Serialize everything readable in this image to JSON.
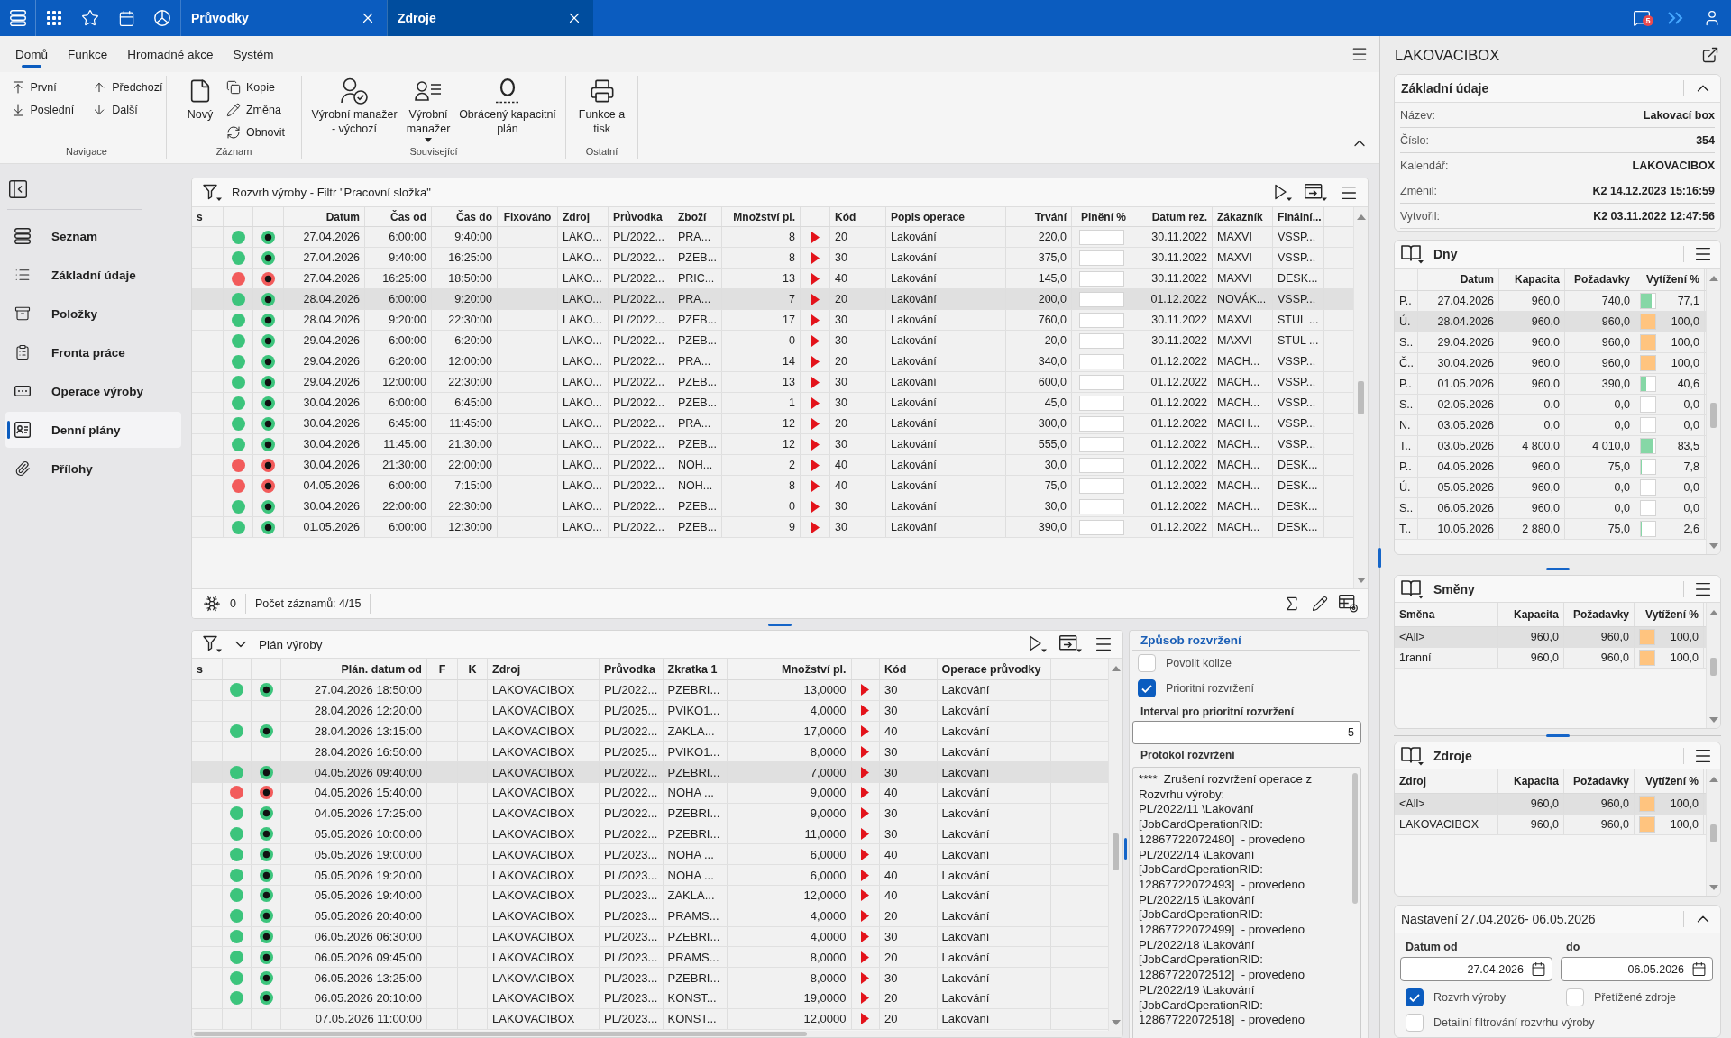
{
  "app_bar": {
    "tabs": [
      {
        "label": "Průvodky",
        "selected": false
      },
      {
        "label": "Zdroje",
        "selected": true
      }
    ],
    "notifications": "5"
  },
  "ribbon": {
    "tabs": [
      {
        "label": "Domů",
        "selected": true
      },
      {
        "label": "Funkce",
        "selected": false
      },
      {
        "label": "Hromadné akce",
        "selected": false
      },
      {
        "label": "Systém",
        "selected": false
      }
    ],
    "groups": [
      {
        "label": "Navigace",
        "kind": "grid",
        "items": [
          {
            "label": "První",
            "kind": "small"
          },
          {
            "label": "Předchozí",
            "kind": "small"
          },
          {
            "label": "Poslední",
            "kind": "small"
          },
          {
            "label": "Další",
            "kind": "small"
          }
        ]
      },
      {
        "label": "Záznam",
        "kind": "stack",
        "items": [
          {
            "label": "Nový",
            "kind": "large"
          },
          {
            "label": "Kopie",
            "kind": "small"
          },
          {
            "label": "Změna",
            "kind": "small"
          },
          {
            "label": "Obnovit",
            "kind": "small"
          }
        ]
      },
      {
        "label": "Související",
        "items": [
          {
            "label": "Výrobní manažer - výchozí",
            "kind": "large"
          },
          {
            "label": "Výrobní manažer",
            "kind": "menu"
          },
          {
            "label": "Obrácený kapacitní plán",
            "kind": "large"
          }
        ]
      },
      {
        "label": "Ostatní",
        "items": [
          {
            "label": "Funkce a tisk",
            "kind": "large"
          }
        ]
      }
    ]
  },
  "sidebar": {
    "items": [
      {
        "label": "Seznam",
        "selected": false
      },
      {
        "label": "Základní údaje",
        "selected": false
      },
      {
        "label": "Položky",
        "selected": false
      },
      {
        "label": "Fronta práce",
        "selected": false
      },
      {
        "label": "Operace výroby",
        "selected": false
      },
      {
        "label": "Denní plány",
        "selected": true
      },
      {
        "label": "Přílohy",
        "selected": false
      }
    ]
  },
  "schedule": {
    "title": "Rozvrh výroby - Filtr \"Pracovní složka\"",
    "columns": [
      {
        "label": "s",
        "kind": "text"
      },
      {
        "kind": "dot"
      },
      {
        "kind": "ring"
      },
      {
        "label": "Datum",
        "kind": "num"
      },
      {
        "label": "Čas od",
        "kind": "num"
      },
      {
        "label": "Čas do",
        "kind": "num"
      },
      {
        "label": "Fixováno",
        "kind": "center"
      },
      {
        "label": "Zdroj",
        "kind": "text"
      },
      {
        "label": "Průvodka",
        "kind": "text"
      },
      {
        "label": "Zboží",
        "kind": "text"
      },
      {
        "label": "Množství pl.",
        "kind": "num"
      },
      {
        "kind": "flag"
      },
      {
        "label": "Kód",
        "kind": "text"
      },
      {
        "label": "Popis operace",
        "kind": "text"
      },
      {
        "label": "Trvání",
        "kind": "num"
      },
      {
        "label": "Plnění %",
        "kind": "bar"
      },
      {
        "label": "Datum rez.",
        "kind": "num"
      },
      {
        "label": "Zákazník",
        "kind": "text"
      },
      {
        "label": "Finální...",
        "kind": "text"
      }
    ],
    "rows": [
      {
        "status": {
          "color": "#3cc47c"
        },
        "state": {
          "color": "#3cc47c"
        },
        "datum": "27.04.2026",
        "od": "6:00:00",
        "cas_do": "9:40:00",
        "zdroj": "LAKO...",
        "pruvodka": "PL/2022...",
        "zbozi": "PRA...",
        "mnozstvi": "8",
        "kod": "20",
        "popis": "Lakování",
        "trvani": "220,0",
        "plneni": {
          "level": 0
        },
        "rez": "30.11.2022",
        "zakaznik": "MAXVI",
        "finalni": "VSSP...",
        "selected": false
      },
      {
        "status": {
          "color": "#3cc47c"
        },
        "state": {
          "color": "#3cc47c"
        },
        "datum": "27.04.2026",
        "od": "9:40:00",
        "cas_do": "16:25:00",
        "zdroj": "LAKO...",
        "pruvodka": "PL/2022...",
        "zbozi": "PZEB...",
        "mnozstvi": "8",
        "kod": "30",
        "popis": "Lakování",
        "trvani": "375,0",
        "plneni": {
          "level": 0
        },
        "rez": "30.11.2022",
        "zakaznik": "MAXVI",
        "finalni": "VSSP...",
        "selected": false
      },
      {
        "status": {
          "color": "#f25b5b"
        },
        "state": {
          "color": "#f25b5b"
        },
        "datum": "27.04.2026",
        "od": "16:25:00",
        "cas_do": "18:50:00",
        "zdroj": "LAKO...",
        "pruvodka": "PL/2022...",
        "zbozi": "PRIC...",
        "mnozstvi": "13",
        "kod": "40",
        "popis": "Lakování",
        "trvani": "145,0",
        "plneni": {
          "level": 0
        },
        "rez": "30.11.2022",
        "zakaznik": "MAXVI",
        "finalni": "DESK...",
        "selected": false
      },
      {
        "status": {
          "color": "#3cc47c"
        },
        "state": {
          "color": "#3cc47c"
        },
        "datum": "28.04.2026",
        "od": "6:00:00",
        "cas_do": "9:20:00",
        "zdroj": "LAKO...",
        "pruvodka": "PL/2022...",
        "zbozi": "PRA...",
        "mnozstvi": "7",
        "kod": "20",
        "popis": "Lakování",
        "trvani": "200,0",
        "plneni": {
          "level": 0
        },
        "rez": "01.12.2022",
        "zakaznik": "NOVÁK...",
        "finalni": "VSSP...",
        "selected": true
      },
      {
        "status": {
          "color": "#3cc47c"
        },
        "state": {
          "color": "#3cc47c"
        },
        "datum": "28.04.2026",
        "od": "9:20:00",
        "cas_do": "22:30:00",
        "zdroj": "LAKO...",
        "pruvodka": "PL/2022...",
        "zbozi": "PZEB...",
        "mnozstvi": "17",
        "kod": "30",
        "popis": "Lakování",
        "trvani": "760,0",
        "plneni": {
          "level": 0
        },
        "rez": "30.11.2022",
        "zakaznik": "MAXVI",
        "finalni": "STUL ...",
        "selected": false
      },
      {
        "status": {
          "color": "#3cc47c"
        },
        "state": {
          "color": "#3cc47c"
        },
        "datum": "29.04.2026",
        "od": "6:00:00",
        "cas_do": "6:20:00",
        "zdroj": "LAKO...",
        "pruvodka": "PL/2022...",
        "zbozi": "PZEB...",
        "mnozstvi": "0",
        "kod": "30",
        "popis": "Lakování",
        "trvani": "20,0",
        "plneni": {
          "level": 0
        },
        "rez": "30.11.2022",
        "zakaznik": "MAXVI",
        "finalni": "STUL ...",
        "selected": false
      },
      {
        "status": {
          "color": "#3cc47c"
        },
        "state": {
          "color": "#3cc47c"
        },
        "datum": "29.04.2026",
        "od": "6:20:00",
        "cas_do": "12:00:00",
        "zdroj": "LAKO...",
        "pruvodka": "PL/2022...",
        "zbozi": "PRA...",
        "mnozstvi": "14",
        "kod": "20",
        "popis": "Lakování",
        "trvani": "340,0",
        "plneni": {
          "level": 0
        },
        "rez": "01.12.2022",
        "zakaznik": "MACH...",
        "finalni": "VSSP...",
        "selected": false
      },
      {
        "status": {
          "color": "#3cc47c"
        },
        "state": {
          "color": "#3cc47c"
        },
        "datum": "29.04.2026",
        "od": "12:00:00",
        "cas_do": "22:30:00",
        "zdroj": "LAKO...",
        "pruvodka": "PL/2022...",
        "zbozi": "PZEB...",
        "mnozstvi": "13",
        "kod": "30",
        "popis": "Lakování",
        "trvani": "600,0",
        "plneni": {
          "level": 0
        },
        "rez": "01.12.2022",
        "zakaznik": "MACH...",
        "finalni": "VSSP...",
        "selected": false
      },
      {
        "status": {
          "color": "#3cc47c"
        },
        "state": {
          "color": "#3cc47c"
        },
        "datum": "30.04.2026",
        "od": "6:00:00",
        "cas_do": "6:45:00",
        "zdroj": "LAKO...",
        "pruvodka": "PL/2022...",
        "zbozi": "PZEB...",
        "mnozstvi": "1",
        "kod": "30",
        "popis": "Lakování",
        "trvani": "45,0",
        "plneni": {
          "level": 0
        },
        "rez": "01.12.2022",
        "zakaznik": "MACH...",
        "finalni": "VSSP...",
        "selected": false
      },
      {
        "status": {
          "color": "#3cc47c"
        },
        "state": {
          "color": "#3cc47c"
        },
        "datum": "30.04.2026",
        "od": "6:45:00",
        "cas_do": "11:45:00",
        "zdroj": "LAKO...",
        "pruvodka": "PL/2022...",
        "zbozi": "PRA...",
        "mnozstvi": "12",
        "kod": "20",
        "popis": "Lakování",
        "trvani": "300,0",
        "plneni": {
          "level": 0
        },
        "rez": "01.12.2022",
        "zakaznik": "MACH...",
        "finalni": "VSSP...",
        "selected": false
      },
      {
        "status": {
          "color": "#3cc47c"
        },
        "state": {
          "color": "#3cc47c"
        },
        "datum": "30.04.2026",
        "od": "11:45:00",
        "cas_do": "21:30:00",
        "zdroj": "LAKO...",
        "pruvodka": "PL/2022...",
        "zbozi": "PZEB...",
        "mnozstvi": "12",
        "kod": "30",
        "popis": "Lakování",
        "trvani": "555,0",
        "plneni": {
          "level": 0
        },
        "rez": "01.12.2022",
        "zakaznik": "MACH...",
        "finalni": "VSSP...",
        "selected": false
      },
      {
        "status": {
          "color": "#f25b5b"
        },
        "state": {
          "color": "#f25b5b"
        },
        "datum": "30.04.2026",
        "od": "21:30:00",
        "cas_do": "22:00:00",
        "zdroj": "LAKO...",
        "pruvodka": "PL/2022...",
        "zbozi": "NOH...",
        "mnozstvi": "2",
        "kod": "40",
        "popis": "Lakování",
        "trvani": "30,0",
        "plneni": {
          "level": 0
        },
        "rez": "01.12.2022",
        "zakaznik": "MACH...",
        "finalni": "DESK...",
        "selected": false
      },
      {
        "status": {
          "color": "#f25b5b"
        },
        "state": {
          "color": "#f25b5b"
        },
        "datum": "04.05.2026",
        "od": "6:00:00",
        "cas_do": "7:15:00",
        "zdroj": "LAKO...",
        "pruvodka": "PL/2022...",
        "zbozi": "NOH...",
        "mnozstvi": "8",
        "kod": "40",
        "popis": "Lakování",
        "trvani": "75,0",
        "plneni": {
          "level": 0
        },
        "rez": "01.12.2022",
        "zakaznik": "MACH...",
        "finalni": "DESK...",
        "selected": false
      },
      {
        "status": {
          "color": "#3cc47c"
        },
        "state": {
          "color": "#3cc47c"
        },
        "datum": "30.04.2026",
        "od": "22:00:00",
        "cas_do": "22:30:00",
        "zdroj": "LAKO...",
        "pruvodka": "PL/2022...",
        "zbozi": "PZEB...",
        "mnozstvi": "0",
        "kod": "30",
        "popis": "Lakování",
        "trvani": "30,0",
        "plneni": {
          "level": 0
        },
        "rez": "01.12.2022",
        "zakaznik": "MACH...",
        "finalni": "DESK...",
        "selected": false
      },
      {
        "status": {
          "color": "#3cc47c"
        },
        "state": {
          "color": "#3cc47c"
        },
        "datum": "01.05.2026",
        "od": "6:00:00",
        "cas_do": "12:30:00",
        "zdroj": "LAKO...",
        "pruvodka": "PL/2022...",
        "zbozi": "PZEB...",
        "mnozstvi": "9",
        "kod": "30",
        "popis": "Lakování",
        "trvani": "390,0",
        "plneni": {
          "level": 0
        },
        "rez": "01.12.2022",
        "zakaznik": "MACH...",
        "finalni": "DESK...",
        "selected": false
      }
    ],
    "footer": {
      "count": "0",
      "records": "Počet záznamů: 4/15"
    }
  },
  "plan": {
    "title": "Plán výroby",
    "columns": [
      {
        "label": "s",
        "kind": "text"
      },
      {
        "kind": "dot"
      },
      {
        "kind": "ring"
      },
      {
        "label": "Plán. datum od",
        "kind": "num"
      },
      {
        "label": "F",
        "kind": "center"
      },
      {
        "label": "K",
        "kind": "center"
      },
      {
        "label": "Zdroj",
        "kind": "text"
      },
      {
        "label": "Průvodka",
        "kind": "text"
      },
      {
        "label": "Zkratka 1",
        "kind": "text"
      },
      {
        "label": "Množství pl.",
        "kind": "num"
      },
      {
        "kind": "flag"
      },
      {
        "label": "Kód",
        "kind": "text"
      },
      {
        "label": "Operace průvodky",
        "kind": "text"
      }
    ],
    "rows": [
      {
        "status": {
          "color": "#3cc47c"
        },
        "state": {
          "color": "#3cc47c"
        },
        "datum": "27.04.2026 18:50:00",
        "zdroj": "LAKOVACIBOX",
        "pruvodka": "PL/2022...",
        "zkratka": "PZEBRI...",
        "mnozstvi": "13,0000",
        "kod": "30",
        "operace": "Lakování",
        "selected": false
      },
      {
        "datum": "28.04.2026 12:20:00",
        "zdroj": "LAKOVACIBOX",
        "pruvodka": "PL/2025...",
        "zkratka": "PVIKO1...",
        "mnozstvi": "4,0000",
        "kod": "30",
        "operace": "Lakování",
        "selected": false
      },
      {
        "status": {
          "color": "#3cc47c"
        },
        "state": {
          "color": "#3cc47c"
        },
        "datum": "28.04.2026 13:15:00",
        "zdroj": "LAKOVACIBOX",
        "pruvodka": "PL/2022...",
        "zkratka": "ZAKLA...",
        "mnozstvi": "17,0000",
        "kod": "40",
        "operace": "Lakování",
        "selected": false
      },
      {
        "datum": "28.04.2026 16:50:00",
        "zdroj": "LAKOVACIBOX",
        "pruvodka": "PL/2025...",
        "zkratka": "PVIKO1...",
        "mnozstvi": "8,0000",
        "kod": "30",
        "operace": "Lakování",
        "selected": false
      },
      {
        "status": {
          "color": "#3cc47c"
        },
        "state": {
          "color": "#3cc47c"
        },
        "datum": "04.05.2026 09:40:00",
        "zdroj": "LAKOVACIBOX",
        "pruvodka": "PL/2022...",
        "zkratka": "PZEBRI...",
        "mnozstvi": "7,0000",
        "kod": "30",
        "operace": "Lakování",
        "selected": true
      },
      {
        "status": {
          "color": "#f25b5b"
        },
        "state": {
          "color": "#f25b5b"
        },
        "datum": "04.05.2026 15:40:00",
        "zdroj": "LAKOVACIBOX",
        "pruvodka": "PL/2022...",
        "zkratka": "NOHA ...",
        "mnozstvi": "9,0000",
        "kod": "40",
        "operace": "Lakování",
        "selected": false
      },
      {
        "status": {
          "color": "#3cc47c"
        },
        "state": {
          "color": "#3cc47c"
        },
        "datum": "04.05.2026 17:25:00",
        "zdroj": "LAKOVACIBOX",
        "pruvodka": "PL/2022...",
        "zkratka": "PZEBRI...",
        "mnozstvi": "9,0000",
        "kod": "30",
        "operace": "Lakování",
        "selected": false
      },
      {
        "status": {
          "color": "#3cc47c"
        },
        "state": {
          "color": "#3cc47c"
        },
        "datum": "05.05.2026 10:00:00",
        "zdroj": "LAKOVACIBOX",
        "pruvodka": "PL/2022...",
        "zkratka": "PZEBRI...",
        "mnozstvi": "11,0000",
        "kod": "30",
        "operace": "Lakování",
        "selected": false
      },
      {
        "status": {
          "color": "#3cc47c"
        },
        "state": {
          "color": "#3cc47c"
        },
        "datum": "05.05.2026 19:00:00",
        "zdroj": "LAKOVACIBOX",
        "pruvodka": "PL/2023...",
        "zkratka": "NOHA ...",
        "mnozstvi": "6,0000",
        "kod": "40",
        "operace": "Lakování",
        "selected": false
      },
      {
        "status": {
          "color": "#3cc47c"
        },
        "state": {
          "color": "#3cc47c"
        },
        "datum": "05.05.2026 19:20:00",
        "zdroj": "LAKOVACIBOX",
        "pruvodka": "PL/2023...",
        "zkratka": "NOHA ...",
        "mnozstvi": "6,0000",
        "kod": "40",
        "operace": "Lakování",
        "selected": false
      },
      {
        "status": {
          "color": "#3cc47c"
        },
        "state": {
          "color": "#3cc47c"
        },
        "datum": "05.05.2026 19:40:00",
        "zdroj": "LAKOVACIBOX",
        "pruvodka": "PL/2023...",
        "zkratka": "ZAKLA...",
        "mnozstvi": "12,0000",
        "kod": "40",
        "operace": "Lakování",
        "selected": false
      },
      {
        "status": {
          "color": "#3cc47c"
        },
        "state": {
          "color": "#3cc47c"
        },
        "datum": "05.05.2026 20:40:00",
        "zdroj": "LAKOVACIBOX",
        "pruvodka": "PL/2023...",
        "zkratka": "PRAMS...",
        "mnozstvi": "4,0000",
        "kod": "20",
        "operace": "Lakování",
        "selected": false
      },
      {
        "status": {
          "color": "#3cc47c"
        },
        "state": {
          "color": "#3cc47c"
        },
        "datum": "06.05.2026 06:30:00",
        "zdroj": "LAKOVACIBOX",
        "pruvodka": "PL/2023...",
        "zkratka": "PZEBRI...",
        "mnozstvi": "4,0000",
        "kod": "30",
        "operace": "Lakování",
        "selected": false
      },
      {
        "status": {
          "color": "#3cc47c"
        },
        "state": {
          "color": "#3cc47c"
        },
        "datum": "06.05.2026 09:45:00",
        "zdroj": "LAKOVACIBOX",
        "pruvodka": "PL/2023...",
        "zkratka": "PRAMS...",
        "mnozstvi": "8,0000",
        "kod": "20",
        "operace": "Lakování",
        "selected": false
      },
      {
        "status": {
          "color": "#3cc47c"
        },
        "state": {
          "color": "#3cc47c"
        },
        "datum": "06.05.2026 13:25:00",
        "zdroj": "LAKOVACIBOX",
        "pruvodka": "PL/2023...",
        "zkratka": "PZEBRI...",
        "mnozstvi": "8,0000",
        "kod": "30",
        "operace": "Lakování",
        "selected": false
      },
      {
        "status": {
          "color": "#3cc47c"
        },
        "state": {
          "color": "#3cc47c"
        },
        "datum": "06.05.2026 20:10:00",
        "zdroj": "LAKOVACIBOX",
        "pruvodka": "PL/2023...",
        "zkratka": "KONST...",
        "mnozstvi": "19,0000",
        "kod": "20",
        "operace": "Lakování",
        "selected": false
      },
      {
        "datum": "07.05.2026 11:00:00",
        "zdroj": "LAKOVACIBOX",
        "pruvodka": "PL/2023...",
        "zkratka": "KONST...",
        "mnozstvi": "12,0000",
        "kod": "20",
        "operace": "Lakování",
        "selected": false
      }
    ]
  },
  "scheduling": {
    "title": "Způsob rozvržení",
    "options": [
      {
        "label": "Povolit kolize",
        "checked": false
      },
      {
        "label": "Prioritní rozvržení",
        "checked": true
      }
    ],
    "interval": {
      "label": "Interval pro prioritní rozvržení",
      "value": "5"
    },
    "log": {
      "label": "Protokol rozvržení",
      "entries": [
        "****  Zrušení rozvržení operace z Rozvrhu výroby:",
        "PL/2022/11 \\Lakování [JobCardOperationRID: 12867722072480]  - provedeno",
        "PL/2022/14 \\Lakování [JobCardOperationRID: 12867722072493]  - provedeno",
        "PL/2022/15 \\Lakování [JobCardOperationRID: 12867722072499]  - provedeno",
        "PL/2022/18 \\Lakování [JobCardOperationRID: 12867722072512]  - provedeno",
        "PL/2022/19 \\Lakování [JobCardOperationRID: 12867722072518]  - provedeno"
      ]
    }
  },
  "resource": {
    "title": "LAKOVACIBOX",
    "basic": {
      "title": "Základní údaje",
      "expanded": true,
      "fields": [
        {
          "label": "Název:",
          "value": "Lakovací box"
        },
        {
          "label": "Číslo:",
          "value": "354"
        },
        {
          "label": "Kalendář:",
          "value": "LAKOVACIBOX"
        },
        {
          "label": "Změnil:",
          "value": "K2 14.12.2023 15:16:59"
        },
        {
          "label": "Vytvořil:",
          "value": "K2 03.11.2022 12:47:56"
        }
      ]
    },
    "days": {
      "title": "Dny",
      "columns": [
        {
          "kind": "text"
        },
        {
          "label": "Datum",
          "kind": "num"
        },
        {
          "label": "Kapacita",
          "kind": "num"
        },
        {
          "label": "Požadavky",
          "kind": "num"
        },
        {
          "label": "Vytížení %",
          "kind": "barnum"
        }
      ],
      "rows": [
        {
          "den": "P..",
          "datum": "27.04.2026",
          "kapacita": "960,0",
          "pozadavky": "740,0",
          "vytizeni": {
            "level": 0.771,
            "text": "77,1"
          },
          "selected": false
        },
        {
          "den": "Ú.",
          "datum": "28.04.2026",
          "kapacita": "960,0",
          "pozadavky": "960,0",
          "vytizeni": {
            "level": 1,
            "text": "100,0"
          },
          "selected": true
        },
        {
          "den": "S..",
          "datum": "29.04.2026",
          "kapacita": "960,0",
          "pozadavky": "960,0",
          "vytizeni": {
            "level": 1,
            "text": "100,0"
          },
          "selected": false
        },
        {
          "den": "Č..",
          "datum": "30.04.2026",
          "kapacita": "960,0",
          "pozadavky": "960,0",
          "vytizeni": {
            "level": 1,
            "text": "100,0"
          },
          "selected": false
        },
        {
          "den": "P..",
          "datum": "01.05.2026",
          "kapacita": "960,0",
          "pozadavky": "390,0",
          "vytizeni": {
            "level": 0.406,
            "text": "40,6"
          },
          "selected": false
        },
        {
          "den": "S..",
          "datum": "02.05.2026",
          "kapacita": "0,0",
          "pozadavky": "0,0",
          "vytizeni": {
            "level": 0,
            "text": "0,0"
          },
          "selected": false
        },
        {
          "den": "N.",
          "datum": "03.05.2026",
          "kapacita": "0,0",
          "pozadavky": "0,0",
          "vytizeni": {
            "level": 0,
            "text": "0,0"
          },
          "selected": false
        },
        {
          "den": "T..",
          "datum": "03.05.2026",
          "kapacita": "4 800,0",
          "pozadavky": "4 010,0",
          "vytizeni": {
            "level": 0.835,
            "text": "83,5"
          },
          "selected": false
        },
        {
          "den": "P..",
          "datum": "04.05.2026",
          "kapacita": "960,0",
          "pozadavky": "75,0",
          "vytizeni": {
            "level": 0.078,
            "text": "7,8"
          },
          "selected": false
        },
        {
          "den": "Ú.",
          "datum": "05.05.2026",
          "kapacita": "960,0",
          "pozadavky": "0,0",
          "vytizeni": {
            "level": 0,
            "text": "0,0"
          },
          "selected": false
        },
        {
          "den": "S..",
          "datum": "06.05.2026",
          "kapacita": "960,0",
          "pozadavky": "0,0",
          "vytizeni": {
            "level": 0,
            "text": "0,0"
          },
          "selected": false
        },
        {
          "den": "T..",
          "datum": "10.05.2026",
          "kapacita": "2 880,0",
          "pozadavky": "75,0",
          "vytizeni": {
            "level": 0.026,
            "text": "2,6"
          },
          "selected": false
        }
      ]
    },
    "shifts": {
      "title": "Směny",
      "columns": [
        {
          "label": "Směna",
          "kind": "text"
        },
        {
          "label": "Kapacita",
          "kind": "num"
        },
        {
          "label": "Požadavky",
          "kind": "num"
        },
        {
          "label": "Vytížení %",
          "kind": "barnum"
        }
      ],
      "rows": [
        {
          "smena": "<All>",
          "kapacita": "960,0",
          "pozadavky": "960,0",
          "vytizeni": {
            "level": 1,
            "text": "100,0"
          },
          "selected": true
        },
        {
          "smena": "1ranní",
          "kapacita": "960,0",
          "pozadavky": "960,0",
          "vytizeni": {
            "level": 1,
            "text": "100,0"
          },
          "selected": false
        }
      ]
    },
    "sources": {
      "title": "Zdroje",
      "columns": [
        {
          "label": "Zdroj",
          "kind": "text"
        },
        {
          "label": "Kapacita",
          "kind": "num"
        },
        {
          "label": "Požadavky",
          "kind": "num"
        },
        {
          "label": "Vytížení %",
          "kind": "barnum"
        }
      ],
      "rows": [
        {
          "zdroj": "<All>",
          "kapacita": "960,0",
          "pozadavky": "960,0",
          "vytizeni": {
            "level": 1,
            "text": "100,0"
          },
          "selected": true
        },
        {
          "zdroj": "LAKOVACIBOX",
          "kapacita": "960,0",
          "pozadavky": "960,0",
          "vytizeni": {
            "level": 1,
            "text": "100,0"
          },
          "selected": false
        }
      ]
    },
    "settings": {
      "title": "Nastavení 27.04.2026- 06.05.2026",
      "expanded": true,
      "date_from": {
        "label": "Datum od",
        "value": "27.04.2026"
      },
      "date_to": {
        "label": "do",
        "value": "06.05.2026"
      },
      "options": [
        {
          "label": "Rozvrh výroby",
          "checked": true
        },
        {
          "label": "Přetížené zdroje",
          "checked": false
        },
        {
          "label": "Detailní filtrování rozvrhu výroby",
          "checked": false
        }
      ]
    }
  }
}
